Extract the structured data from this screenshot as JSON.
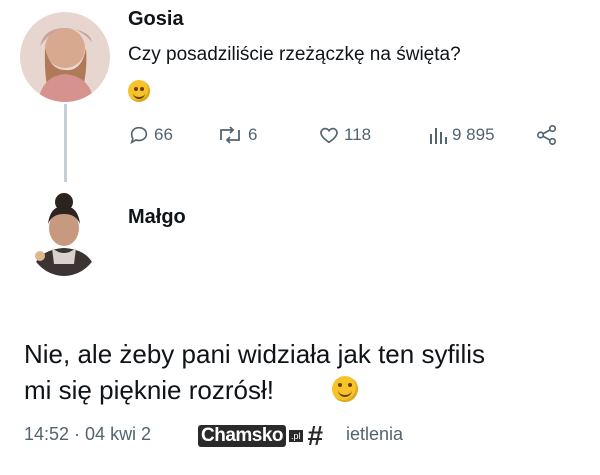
{
  "tweet": {
    "author": "Gosia",
    "text": "Czy posadziliście rzeżączkę na święta?",
    "actions": {
      "replies": "66",
      "reposts": "6",
      "likes": "118",
      "views": "9 895"
    }
  },
  "reply": {
    "author": "Małgo",
    "text_line1": "Nie, ale żeby pani widziała jak ten syfilis",
    "text_line2": "mi się pięknie rozrósł!",
    "timestamp": "14:52 · 04 kwi 2",
    "views_fragment": "ietlenia"
  },
  "watermark": {
    "text": "Chamsko",
    "suffix": ".pl"
  },
  "colors": {
    "text_primary": "#0f1419",
    "text_secondary": "#536471",
    "thread_line": "#c4cfd6"
  }
}
